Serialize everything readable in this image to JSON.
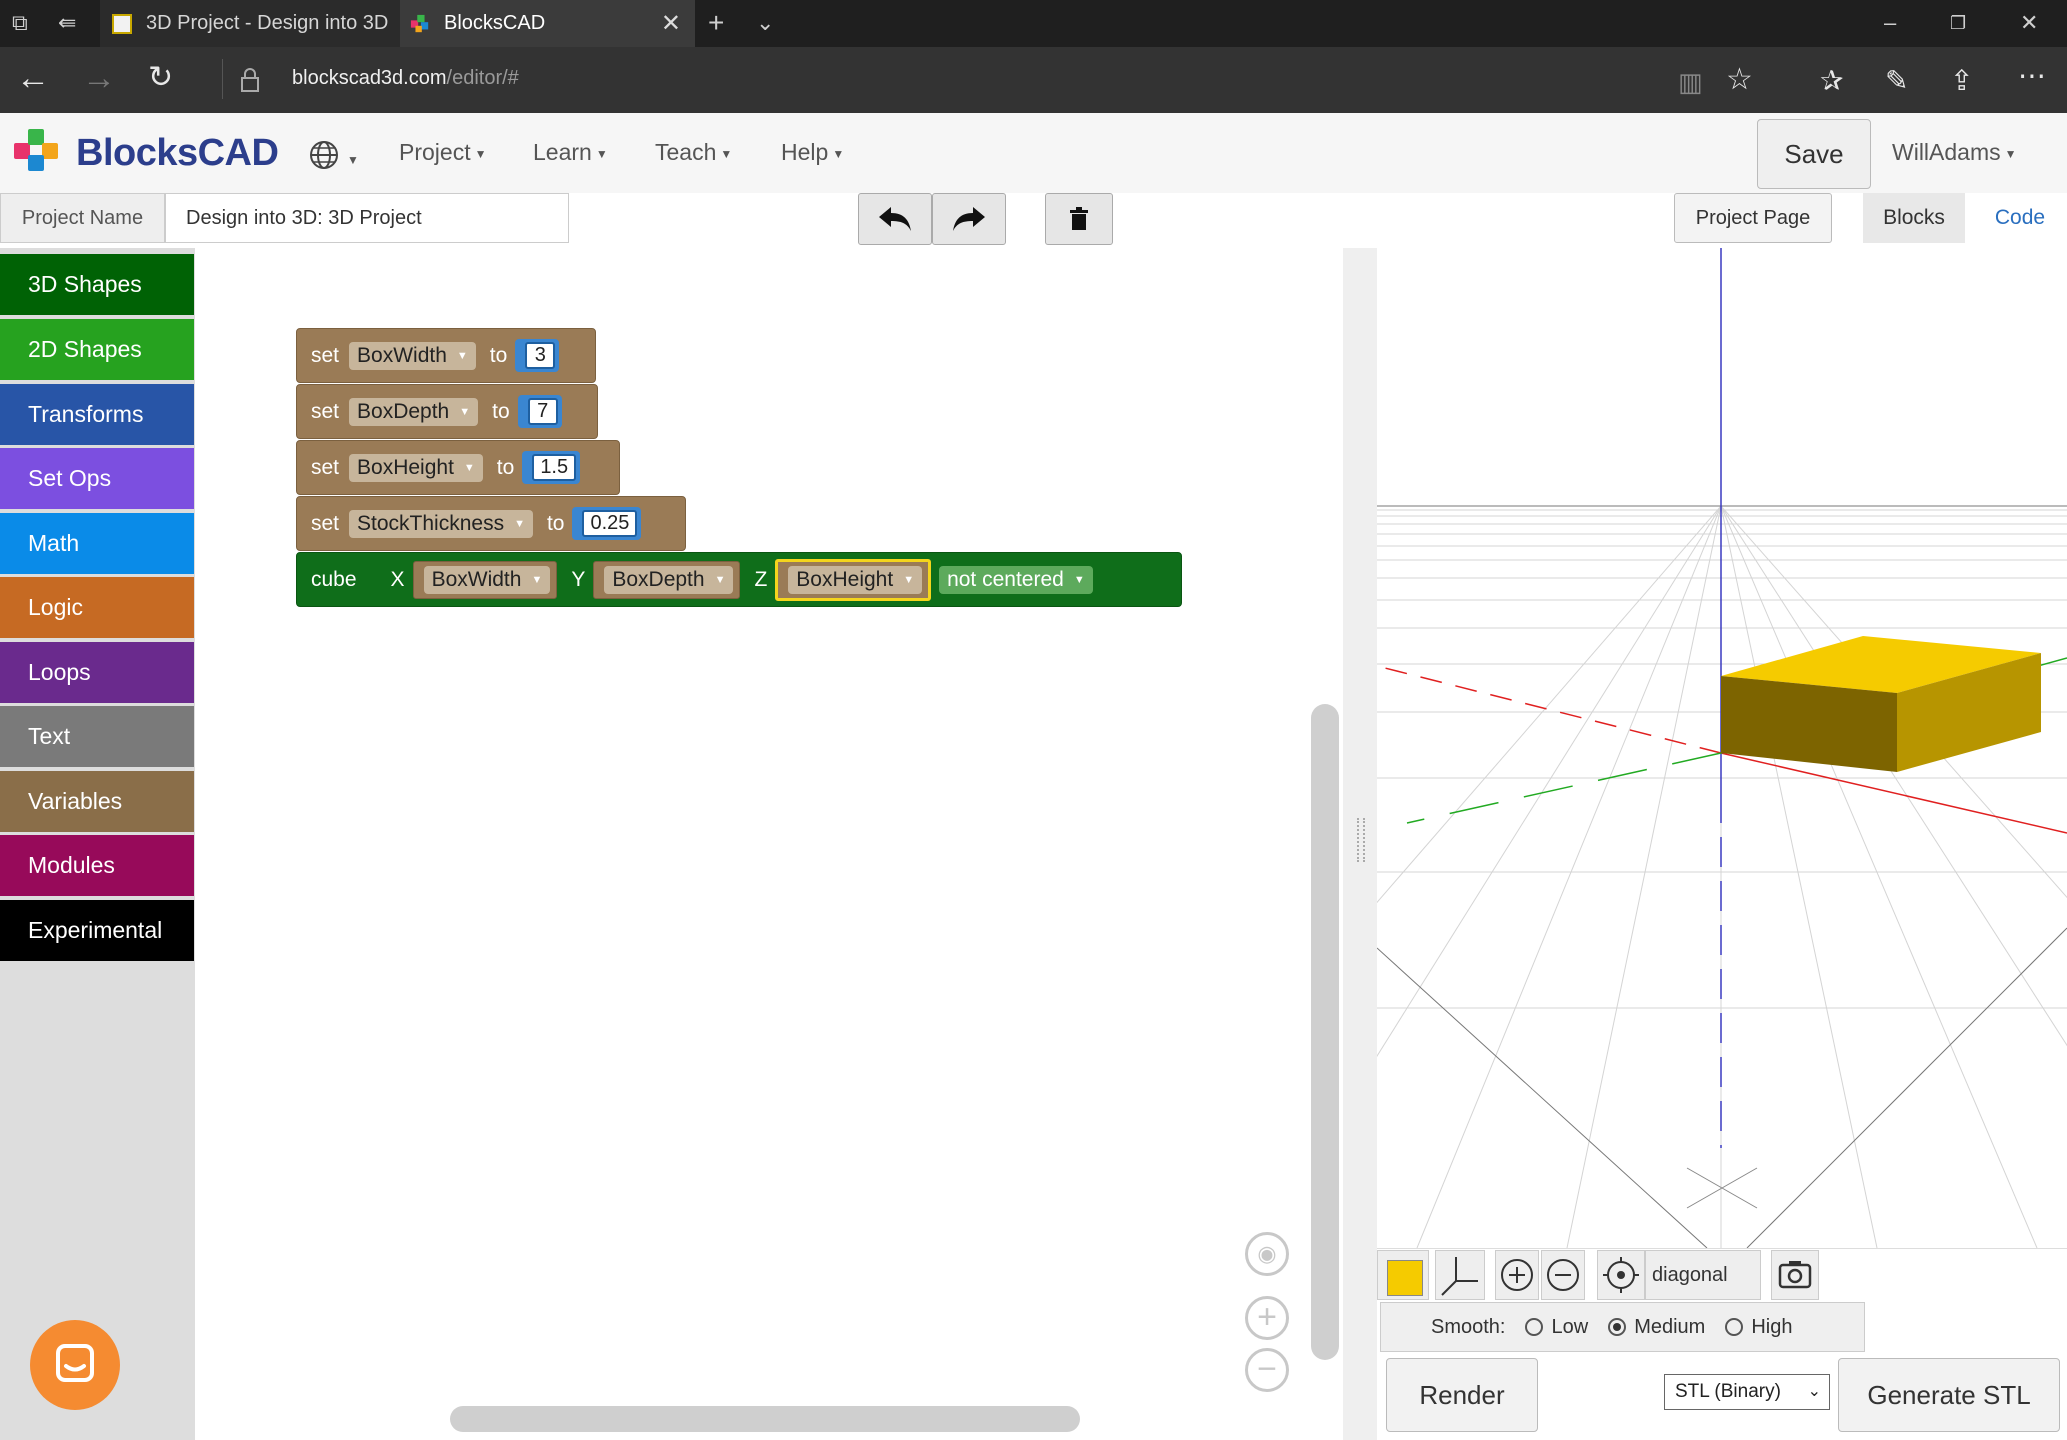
{
  "browser": {
    "tabs": [
      {
        "title": "3D Project - Design into 3D"
      },
      {
        "title": "BlocksCAD"
      }
    ],
    "url_host": "blockscad3d.com",
    "url_path": "/editor/#"
  },
  "app": {
    "logo_text": "BlocksCAD",
    "menu": {
      "project": "Project",
      "learn": "Learn",
      "teach": "Teach",
      "help": "Help"
    },
    "save_label": "Save",
    "user": "WillAdams"
  },
  "toolbar": {
    "project_name_label": "Project Name",
    "project_name_value": "Design into 3D: 3D Project",
    "project_page_label": "Project Page",
    "tab_blocks": "Blocks",
    "tab_code": "Code"
  },
  "categories": [
    {
      "label": "3D Shapes",
      "color": "#006205"
    },
    {
      "label": "2D Shapes",
      "color": "#26a21f"
    },
    {
      "label": "Transforms",
      "color": "#2855a7"
    },
    {
      "label": "Set Ops",
      "color": "#7c4fe0"
    },
    {
      "label": "Math",
      "color": "#0a8be8"
    },
    {
      "label": "Logic",
      "color": "#c66a23"
    },
    {
      "label": "Loops",
      "color": "#6a2a8d"
    },
    {
      "label": "Text",
      "color": "#7a7a7a"
    },
    {
      "label": "Variables",
      "color": "#8a6e49"
    },
    {
      "label": "Modules",
      "color": "#970a5a"
    },
    {
      "label": "Experimental",
      "color": "#000000"
    }
  ],
  "blocks": {
    "set_kw": "set",
    "to_kw": "to",
    "vars": [
      {
        "name": "BoxWidth",
        "value": "3"
      },
      {
        "name": "BoxDepth",
        "value": "7"
      },
      {
        "name": "BoxHeight",
        "value": "1.5"
      },
      {
        "name": "StockThickness",
        "value": "0.25"
      }
    ],
    "cube": {
      "label": "cube",
      "x_label": "X",
      "y_label": "Y",
      "z_label": "Z",
      "x_var": "BoxWidth",
      "y_var": "BoxDepth",
      "z_var": "BoxHeight",
      "centered": "not centered"
    }
  },
  "viewer": {
    "object_color": "#f5cb00",
    "view_mode": "diagonal",
    "smooth_label": "Smooth:",
    "smooth_options": [
      "Low",
      "Medium",
      "High"
    ],
    "smooth_selected": "Medium",
    "render_label": "Render",
    "export_format": "STL (Binary)",
    "generate_label": "Generate STL"
  }
}
